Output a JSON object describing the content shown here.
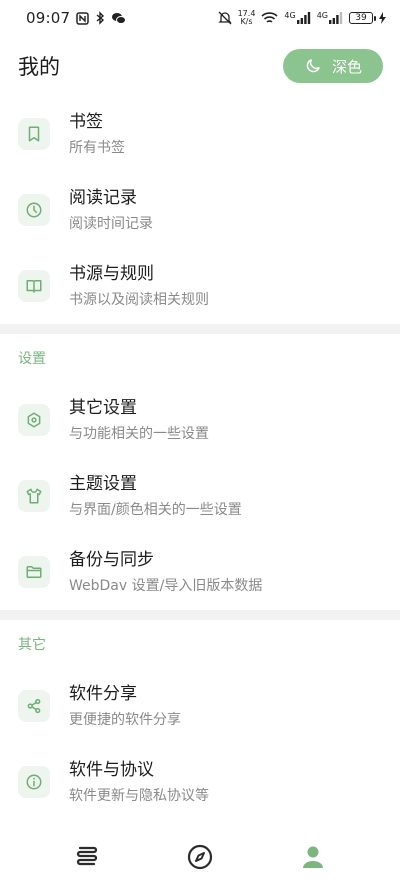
{
  "status_bar": {
    "time": "09:07",
    "net_speed_top": "17.4",
    "net_speed_unit": "K/s",
    "network_1": "4G",
    "network_2": "4G",
    "battery": "39"
  },
  "header": {
    "title": "我的",
    "theme_button": "深色"
  },
  "items_top": [
    {
      "title": "书签",
      "subtitle": "所有书签",
      "icon": "bookmark-icon"
    },
    {
      "title": "阅读记录",
      "subtitle": "阅读时间记录",
      "icon": "clock-icon"
    },
    {
      "title": "书源与规则",
      "subtitle": "书源以及阅读相关规则",
      "icon": "book-open-icon"
    }
  ],
  "section_settings": {
    "label": "设置",
    "items": [
      {
        "title": "其它设置",
        "subtitle": "与功能相关的一些设置",
        "icon": "hexagon-settings-icon"
      },
      {
        "title": "主题设置",
        "subtitle": "与界面/颜色相关的一些设置",
        "icon": "shirt-icon"
      },
      {
        "title": "备份与同步",
        "subtitle": "WebDav 设置/导入旧版本数据",
        "icon": "folder-icon"
      }
    ]
  },
  "section_other": {
    "label": "其它",
    "items": [
      {
        "title": "软件分享",
        "subtitle": "更便捷的软件分享",
        "icon": "share-icon"
      },
      {
        "title": "软件与协议",
        "subtitle": "软件更新与隐私协议等",
        "icon": "info-icon"
      }
    ]
  },
  "bottom_nav": [
    {
      "name": "bookshelf",
      "icon": "bookshelf-icon",
      "active": false
    },
    {
      "name": "discover",
      "icon": "compass-icon",
      "active": false
    },
    {
      "name": "mine",
      "icon": "person-icon",
      "active": true
    }
  ],
  "colors": {
    "accent": "#8bc48f",
    "accent_text": "#7bb57f",
    "icon_bg": "#eef4ee",
    "icon_stroke": "#6fae74",
    "nav_inactive": "#2b2b2b"
  }
}
